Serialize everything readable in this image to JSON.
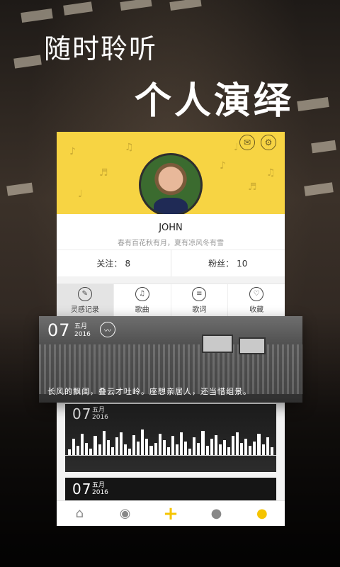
{
  "slogan": {
    "line1": "随时聆听",
    "line2": "个人演绎"
  },
  "profile": {
    "name": "JOHN",
    "motto": "春有百花秋有月，夏有凉风冬有雪",
    "icons": [
      "mailbox-icon",
      "gear-icon"
    ]
  },
  "stats": [
    {
      "label": "关注：",
      "value": "8"
    },
    {
      "label": "粉丝：",
      "value": "10"
    }
  ],
  "tabs": [
    {
      "label": "灵感记录",
      "icon": "edit-icon",
      "glyph": "✎"
    },
    {
      "label": "歌曲",
      "icon": "music-note-icon",
      "glyph": "♫"
    },
    {
      "label": "歌词",
      "icon": "lyrics-icon",
      "glyph": "≡"
    },
    {
      "label": "收藏",
      "icon": "heart-icon",
      "glyph": "♡"
    }
  ],
  "feature": {
    "day": "07",
    "month": "五月",
    "year": "2016",
    "caption": "长风的飘阔，叠云才吐岭。座想亲居人，还当惜组景。"
  },
  "card2": {
    "day": "07",
    "month": "五月",
    "year": "2016"
  },
  "card3": {
    "day": "07",
    "month": "五月",
    "year": "2016"
  },
  "nav": [
    {
      "name": "home-icon",
      "glyph": "⌂"
    },
    {
      "name": "compass-icon",
      "glyph": "◉"
    },
    {
      "name": "add-icon",
      "glyph": "+"
    },
    {
      "name": "bulb-icon",
      "glyph": "●"
    },
    {
      "name": "profile-icon",
      "glyph": "●"
    }
  ],
  "colors": {
    "accent": "#f7d443",
    "nav_active": "#f5c400"
  }
}
